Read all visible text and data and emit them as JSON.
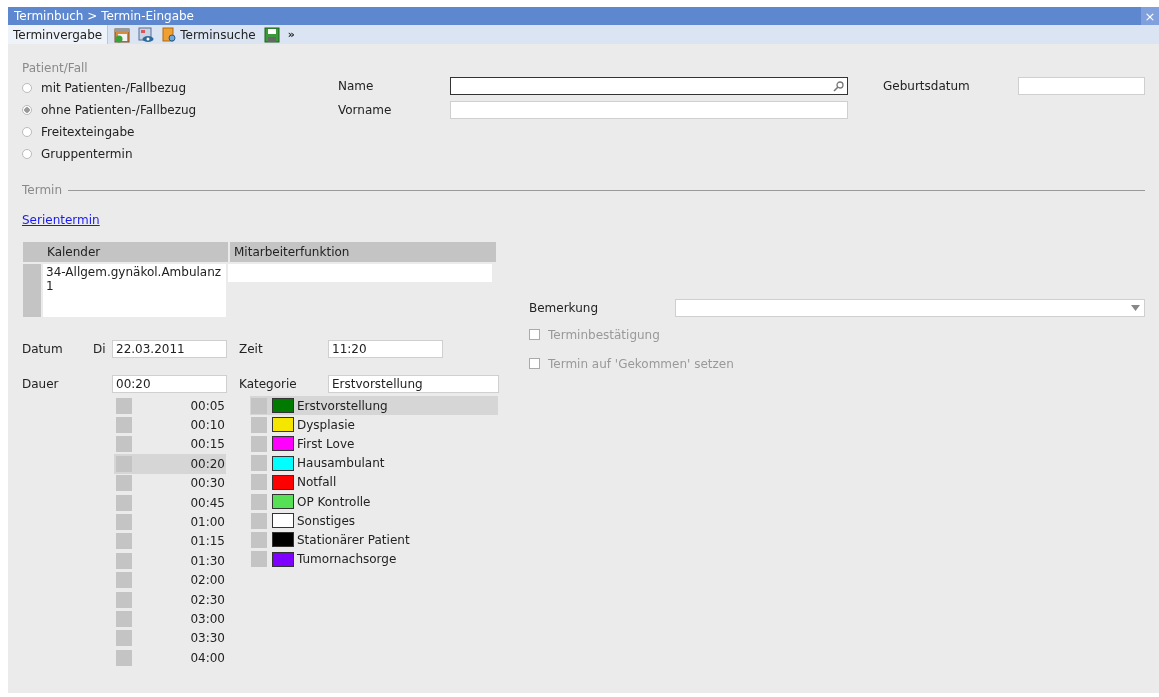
{
  "window": {
    "title": "Terminbuch > Termin-Eingabe",
    "close": "×"
  },
  "toolbar": [
    {
      "kind": "tab",
      "label": "Terminvergabe",
      "selected": true
    },
    {
      "kind": "calendar"
    },
    {
      "kind": "viewer"
    },
    {
      "kind": "search",
      "label": "Terminsuche"
    },
    {
      "kind": "save"
    },
    {
      "kind": "more",
      "label": "»"
    }
  ],
  "patient": {
    "legend": "Patient/Fall",
    "options": [
      {
        "label": "mit Patienten-/Fallbezug",
        "selected": false
      },
      {
        "label": "ohne Patienten-/Fallbezug",
        "selected": true
      },
      {
        "label": "Freitexteingabe",
        "selected": false
      },
      {
        "label": "Gruppentermin",
        "selected": false
      }
    ],
    "name_label": "Name",
    "firstname_label": "Vorname",
    "birthdate_label": "Geburtsdatum"
  },
  "termin": {
    "legend": "Termin",
    "series_link": "Serientermin",
    "table": {
      "columns": [
        "Kalender",
        "Mitarbeiterfunktion"
      ],
      "rows": [
        [
          "34-Allgem.gynäkol.Ambulanz 1",
          ""
        ]
      ]
    },
    "date_label": "Datum",
    "weekday": "Di",
    "date": "22.03.2011",
    "time_label": "Zeit",
    "time": "11:20",
    "duration_label": "Dauer",
    "duration": "00:20",
    "category_label": "Kategorie",
    "category": "Erstvorstellung",
    "durations": [
      {
        "label": "00:05",
        "selected": false
      },
      {
        "label": "00:10",
        "selected": false
      },
      {
        "label": "00:15",
        "selected": false
      },
      {
        "label": "00:20",
        "selected": true
      },
      {
        "label": "00:30",
        "selected": false
      },
      {
        "label": "00:45",
        "selected": false
      },
      {
        "label": "01:00",
        "selected": false
      },
      {
        "label": "01:15",
        "selected": false
      },
      {
        "label": "01:30",
        "selected": false
      },
      {
        "label": "02:00",
        "selected": false
      },
      {
        "label": "02:30",
        "selected": false
      },
      {
        "label": "03:00",
        "selected": false
      },
      {
        "label": "03:30",
        "selected": false
      },
      {
        "label": "04:00",
        "selected": false
      }
    ],
    "categories": [
      {
        "label": "Erstvorstellung",
        "color": "#007a00",
        "selected": true
      },
      {
        "label": "Dysplasie",
        "color": "#f5e600",
        "selected": false
      },
      {
        "label": "First Love",
        "color": "#ff00ff",
        "selected": false
      },
      {
        "label": "Hausambulant",
        "color": "#00ffff",
        "selected": false
      },
      {
        "label": "Notfall",
        "color": "#ff0000",
        "selected": false
      },
      {
        "label": "OP Kontrolle",
        "color": "#55e055",
        "selected": false
      },
      {
        "label": "Sonstiges",
        "color": "#ffffff",
        "selected": false
      },
      {
        "label": "Stationärer Patient",
        "color": "#000000",
        "selected": false
      },
      {
        "label": "Tumornachsorge",
        "color": "#7f00ff",
        "selected": false
      }
    ],
    "remark_label": "Bemerkung",
    "checks": [
      {
        "label": "Terminbestätigung",
        "checked": false,
        "disabled": true
      },
      {
        "label": "Termin auf 'Gekommen' setzen",
        "checked": false,
        "disabled": true
      }
    ]
  }
}
